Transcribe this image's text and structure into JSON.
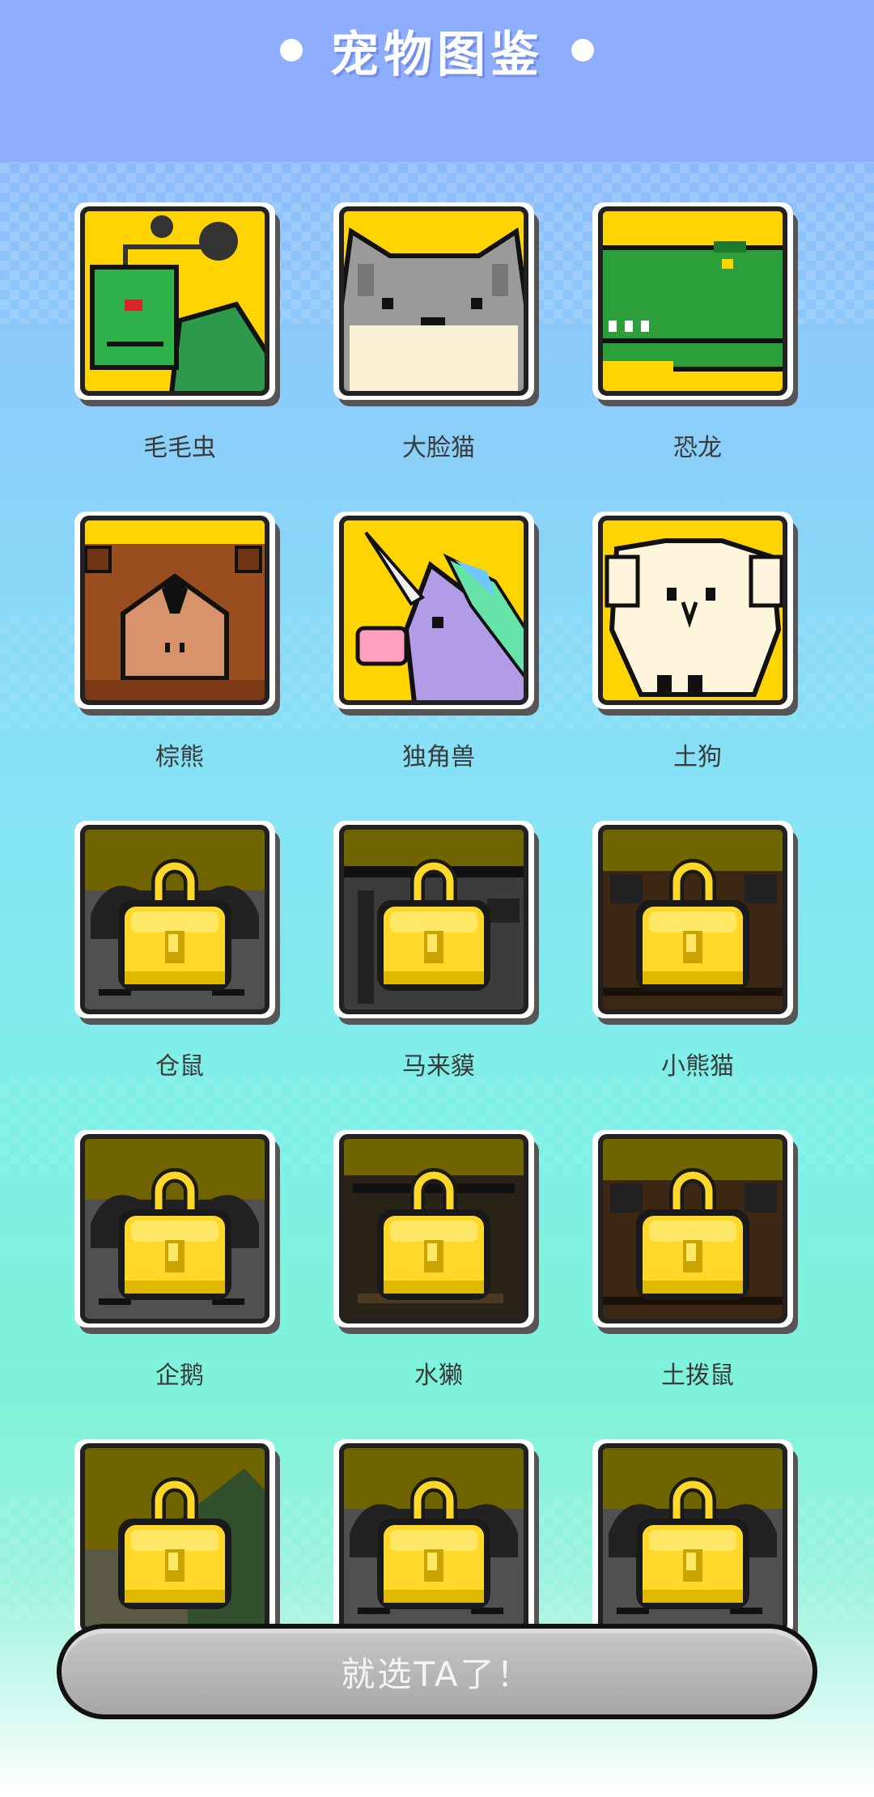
{
  "header": {
    "title": "宠物图鉴"
  },
  "pets": [
    {
      "name": "毛毛虫",
      "locked": false,
      "art": "caterpillar"
    },
    {
      "name": "大脸猫",
      "locked": false,
      "art": "cat"
    },
    {
      "name": "恐龙",
      "locked": false,
      "art": "dino"
    },
    {
      "name": "棕熊",
      "locked": false,
      "art": "bear"
    },
    {
      "name": "独角兽",
      "locked": false,
      "art": "unicorn"
    },
    {
      "name": "土狗",
      "locked": false,
      "art": "dog"
    },
    {
      "name": "仓鼠",
      "locked": true,
      "art": "gray"
    },
    {
      "name": "马来貘",
      "locked": true,
      "art": "tapir"
    },
    {
      "name": "小熊猫",
      "locked": true,
      "art": "brown"
    },
    {
      "name": "企鹅",
      "locked": true,
      "art": "gray"
    },
    {
      "name": "水獭",
      "locked": true,
      "art": "dark"
    },
    {
      "name": "土拨鼠",
      "locked": true,
      "art": "brown"
    },
    {
      "name": "",
      "locked": true,
      "art": "green"
    },
    {
      "name": "",
      "locked": true,
      "art": "gray"
    },
    {
      "name": "",
      "locked": true,
      "art": "gray"
    }
  ],
  "select_button": {
    "label": "就选TA了！"
  },
  "colors": {
    "tile_yellow": "#ffd400",
    "locked_bg": "#6f6400",
    "lock_gold": "#ffd82a"
  }
}
